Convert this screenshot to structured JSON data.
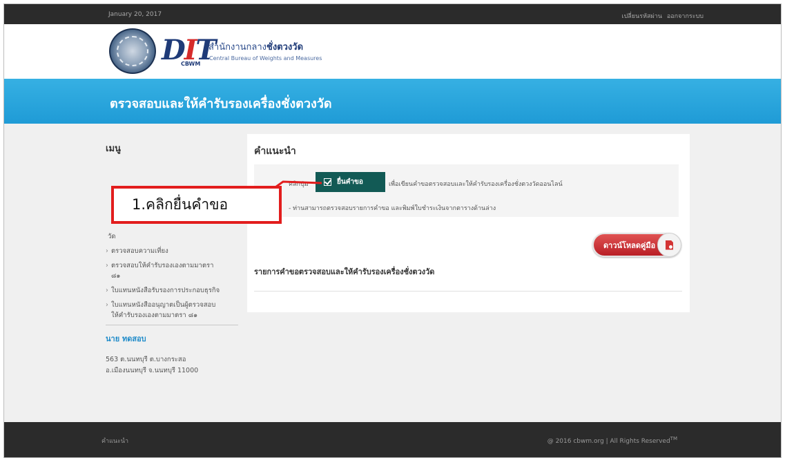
{
  "topbar": {
    "date": "January 20, 2017",
    "change_password": "เปลี่ยนรหัสผ่าน",
    "logout": "ออกจากระบบ"
  },
  "header": {
    "logo_text": "DIT",
    "logo_sub": "CBWM",
    "org_name_th_prefix": "สำนักงานกลาง",
    "org_name_th_bold": "ชั่งตวงวัด",
    "org_name_en": "Central Bureau of Weights and Measures"
  },
  "banner": {
    "title": "ตรวจสอบและให้คำรับรองเครื่องชั่งตวงวัด"
  },
  "sidebar": {
    "heading": "เมนู",
    "items": [
      {
        "line1": "วัด"
      },
      {
        "line1": "ตรวจสอบความเที่ยง"
      },
      {
        "line1": "ตรวจสอบให้คำรับรองเองตามมาตรา",
        "line2": "๘๑"
      },
      {
        "line1": "ใบแทนหนังสือรับรองการประกอบธุรกิจ"
      },
      {
        "line1": "ใบแทนหนังสืออนุญาตเป็นผู้ตรวจสอบ",
        "line2": "ให้คำรับรองเองตามมาตรา ๘๑"
      }
    ],
    "user_name": "นาย ทดสอบ",
    "address_line1": "563 ต.นนทบุรี ต.บางกระสอ",
    "address_line2": "อ.เมืองนนทบุรี จ.นนทบุรี 11000"
  },
  "content": {
    "heading": "คำแนะนำ",
    "click_prefix": "คลิกปุ่ม",
    "submit_button": "ยื่นคำขอ",
    "instruction_line1": "เพื่อเขียนคำขอตรวจสอบและให้คำรับรองเครื่องชั่งตวงวัดออนไลน์",
    "instruction_line2": "- ท่านสามารถตรวจสอบรายการคำขอ และพิมพ์ใบชำระเงินจากตารางด้านล่าง",
    "download_button": "ดาวน์โหลดคู่มือ",
    "list_title": "รายการคำขอตรวจสอบและให้คำรับรองเครื่องชั่งตวงวัด"
  },
  "callout": {
    "text": "1.คลิกยื่นคำขอ"
  },
  "footer": {
    "left_link": "คำแนะนำ",
    "copyright": "@ 2016 cbwm.org | All Rights Reserved",
    "tm": "TM"
  },
  "colors": {
    "banner": "#1f9bd6",
    "submit_button": "#125a55",
    "download_button": "#c62a30",
    "callout_border": "#e21d1d",
    "dark_bar": "#2b2b2b"
  }
}
